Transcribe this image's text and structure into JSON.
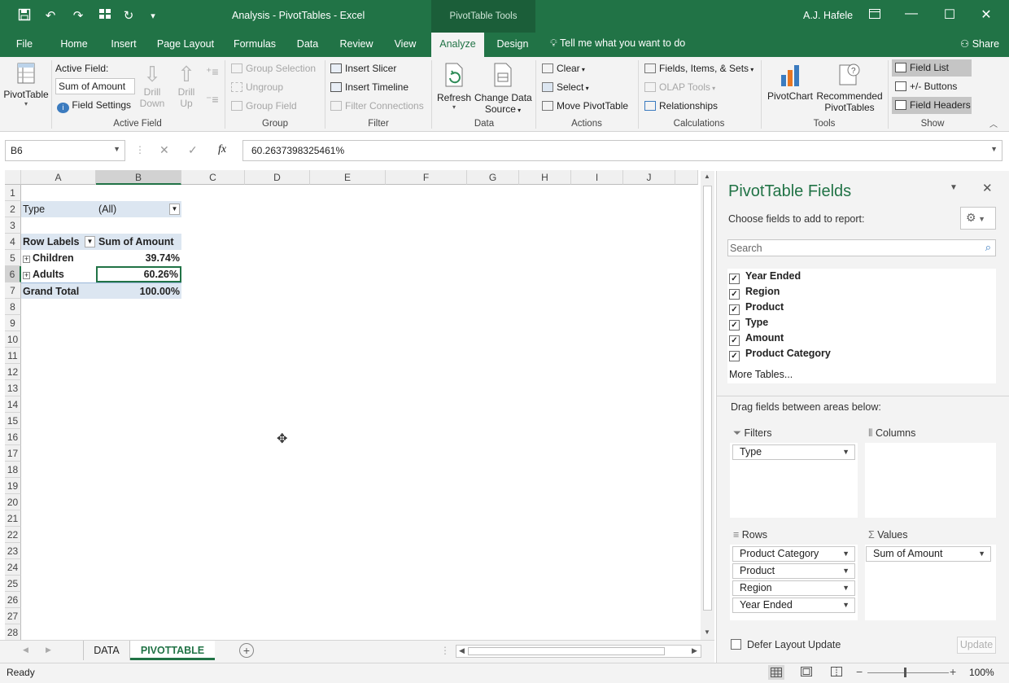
{
  "titlebar": {
    "doc_title": "Analysis - PivotTables  -  Excel",
    "context_tools": "PivotTable Tools",
    "user": "A.J. Hafele"
  },
  "tabs": [
    "File",
    "Home",
    "Insert",
    "Page Layout",
    "Formulas",
    "Data",
    "Review",
    "View",
    "Analyze",
    "Design"
  ],
  "active_tab": "Analyze",
  "tell_me": "Tell me what you want to do",
  "share": "Share",
  "ribbon": {
    "pivottable": "PivotTable",
    "active_field_label": "Active Field:",
    "active_field_value": "Sum of Amount",
    "field_settings": "Field Settings",
    "drill_down": [
      "Drill",
      "Down"
    ],
    "drill_up": [
      "Drill",
      "Up"
    ],
    "group_selection": "Group Selection",
    "ungroup": "Ungroup",
    "group_field": "Group Field",
    "insert_slicer": "Insert Slicer",
    "insert_timeline": "Insert Timeline",
    "filter_connections": "Filter Connections",
    "refresh": "Refresh",
    "change_data_source": [
      "Change Data",
      "Source"
    ],
    "clear": "Clear",
    "select": "Select",
    "move_pivottable": "Move PivotTable",
    "fields_items_sets": "Fields, Items, & Sets",
    "olap_tools": "OLAP Tools",
    "relationships": "Relationships",
    "pivotchart": "PivotChart",
    "recommended": [
      "Recommended",
      "PivotTables"
    ],
    "field_list": "Field List",
    "buttons": "+/- Buttons",
    "field_headers": "Field Headers",
    "groups": {
      "active_field": "Active Field",
      "group": "Group",
      "filter": "Filter",
      "data": "Data",
      "actions": "Actions",
      "calculations": "Calculations",
      "tools": "Tools",
      "show": "Show"
    }
  },
  "formula_bar": {
    "name_box": "B6",
    "formula": "60.2637398325461%"
  },
  "columns": [
    "A",
    "B",
    "C",
    "D",
    "E",
    "F",
    "G",
    "H",
    "I",
    "J"
  ],
  "rows": [
    "1",
    "2",
    "3",
    "4",
    "5",
    "6",
    "7",
    "8",
    "9",
    "10",
    "11",
    "12",
    "13",
    "14",
    "15",
    "16",
    "17",
    "18",
    "19",
    "20",
    "21",
    "22",
    "23",
    "24",
    "25",
    "26",
    "27",
    "28"
  ],
  "pivot": {
    "filter_label": "Type",
    "filter_value": "(All)",
    "row_labels": "Row Labels",
    "sum_header": "Sum of Amount",
    "rows": [
      {
        "label": "Children",
        "value": "39.74%"
      },
      {
        "label": "Adults",
        "value": "60.26%"
      }
    ],
    "grand_total_label": "Grand Total",
    "grand_total_value": "100.00%"
  },
  "sheets": [
    "DATA",
    "PIVOTTABLE"
  ],
  "active_sheet": "PIVOTTABLE",
  "status": {
    "ready": "Ready",
    "zoom": "100%"
  },
  "pane": {
    "title": "PivotTable Fields",
    "subtitle": "Choose fields to add to report:",
    "search_placeholder": "Search",
    "fields": [
      "Year Ended",
      "Region",
      "Product",
      "Type",
      "Amount",
      "Product Category"
    ],
    "more_tables": "More Tables...",
    "drag_hint": "Drag fields between areas below:",
    "filters_title": "Filters",
    "columns_title": "Columns",
    "rows_title": "Rows",
    "values_title": "Values",
    "filters": [
      "Type"
    ],
    "rows": [
      "Product Category",
      "Product",
      "Region",
      "Year Ended"
    ],
    "values": [
      "Sum of Amount"
    ],
    "defer": "Defer Layout Update",
    "update": "Update"
  },
  "colors": {
    "excel_green": "#217346",
    "pivot_header": "#dce6f1",
    "selection": "#217346"
  }
}
